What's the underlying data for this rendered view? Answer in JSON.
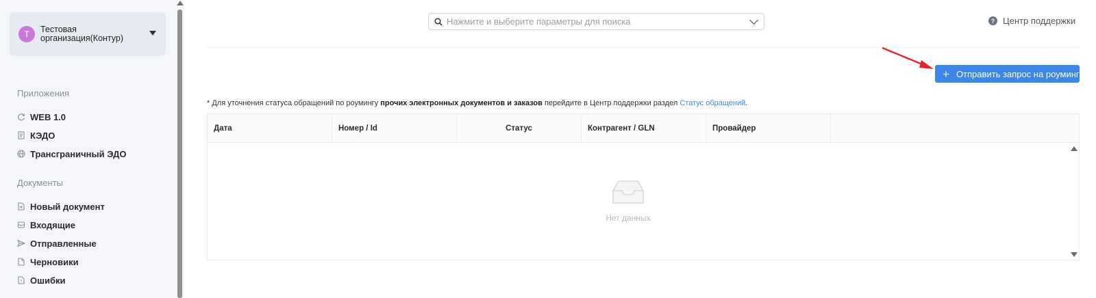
{
  "org": {
    "initial": "Т",
    "name": "Тестовая организация(Контур)"
  },
  "sidebar": {
    "apps_title": "Приложения",
    "apps": [
      {
        "label": "WEB 1.0",
        "icon": "refresh-icon"
      },
      {
        "label": "КЭДО",
        "icon": "document-list-icon"
      },
      {
        "label": "Трансграничный ЭДО",
        "icon": "globe-icon"
      }
    ],
    "docs_title": "Документы",
    "docs": [
      {
        "label": "Новый документ",
        "icon": "new-document-icon"
      },
      {
        "label": "Входящие",
        "icon": "inbox-icon"
      },
      {
        "label": "Отправленные",
        "icon": "send-icon"
      },
      {
        "label": "Черновики",
        "icon": "draft-icon"
      },
      {
        "label": "Ошибки",
        "icon": "error-document-icon"
      }
    ]
  },
  "search": {
    "placeholder": "Нажмите и выберите параметры для поиска"
  },
  "help": {
    "label": "Центр поддержки"
  },
  "actions": {
    "send_roaming": "Отправить запрос на роуминг"
  },
  "note": {
    "prefix": "* Для уточнения статуса обращений по роумингу",
    "bold": "прочих электронных документов и заказов",
    "middle": "перейдите в Центр поддержки раздел",
    "link": "Статус обращений",
    "suffix": "."
  },
  "table": {
    "columns": [
      "Дата",
      "Номер / Id",
      "Статус",
      "Контрагент / GLN",
      "Провайдер",
      ""
    ],
    "empty_text": "Нет данных"
  },
  "colors": {
    "primary": "#3c86ea",
    "avatar": "#c879d8",
    "annotation_arrow": "#e8232a"
  }
}
